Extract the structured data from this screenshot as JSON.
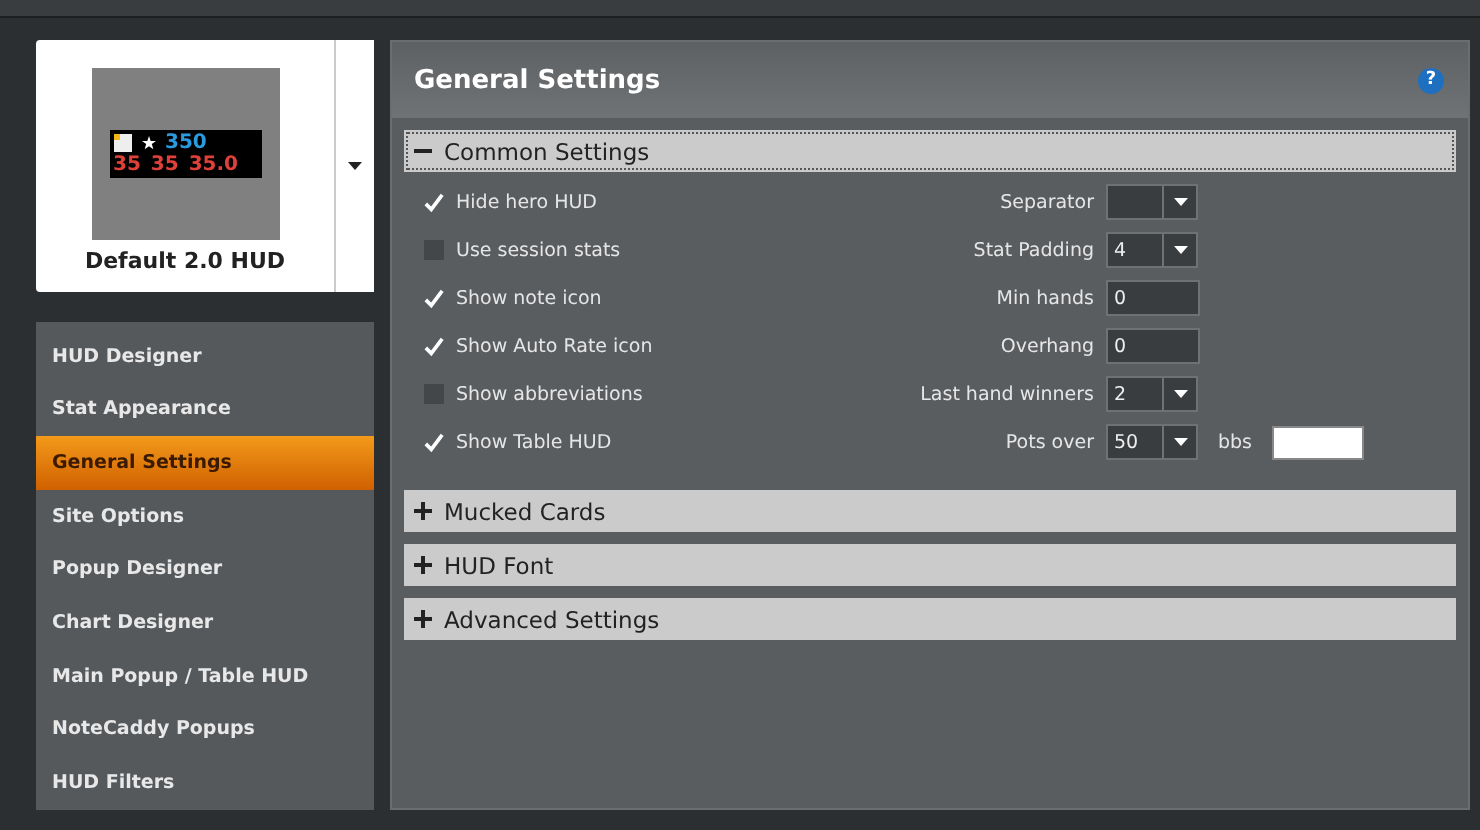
{
  "preview": {
    "name": "Default 2.0 HUD",
    "top_stat": "350",
    "bottom_stats": [
      "35",
      "35",
      "35.0"
    ]
  },
  "sidebar": {
    "items": [
      {
        "label": "HUD Designer",
        "selected": false
      },
      {
        "label": "Stat Appearance",
        "selected": false
      },
      {
        "label": "General Settings",
        "selected": true
      },
      {
        "label": "Site Options",
        "selected": false
      },
      {
        "label": "Popup Designer",
        "selected": false
      },
      {
        "label": "Chart Designer",
        "selected": false
      },
      {
        "label": "Main Popup / Table HUD",
        "selected": false
      },
      {
        "label": "NoteCaddy Popups",
        "selected": false
      },
      {
        "label": "HUD Filters",
        "selected": false
      }
    ]
  },
  "panel": {
    "title": "General Settings",
    "help": "?",
    "sections": [
      {
        "title": "Common Settings",
        "expanded": true,
        "options": [
          {
            "label": "Hide hero HUD",
            "checked": true
          },
          {
            "label": "Use session stats",
            "checked": false
          },
          {
            "label": "Show note icon",
            "checked": true
          },
          {
            "label": "Show Auto Rate icon",
            "checked": true
          },
          {
            "label": "Show abbreviations",
            "checked": false
          },
          {
            "label": "Show Table HUD",
            "checked": true
          }
        ],
        "fields": [
          {
            "label": "Separator",
            "kind": "dropdown"
          },
          {
            "label": "Stat Padding",
            "kind": "dropdown",
            "value": "4"
          },
          {
            "label": "Min hands",
            "kind": "input",
            "value": "0"
          },
          {
            "label": "Overhang",
            "kind": "input",
            "value": "0"
          },
          {
            "label": "Last hand winners",
            "kind": "dropdown",
            "value": "2"
          },
          {
            "label": "Pots over",
            "kind": "dropdown",
            "value": "50",
            "unit": "bbs"
          }
        ]
      },
      {
        "title": "Mucked Cards",
        "expanded": false
      },
      {
        "title": "HUD Font",
        "expanded": false
      },
      {
        "title": "Advanced Settings",
        "expanded": false
      }
    ]
  }
}
